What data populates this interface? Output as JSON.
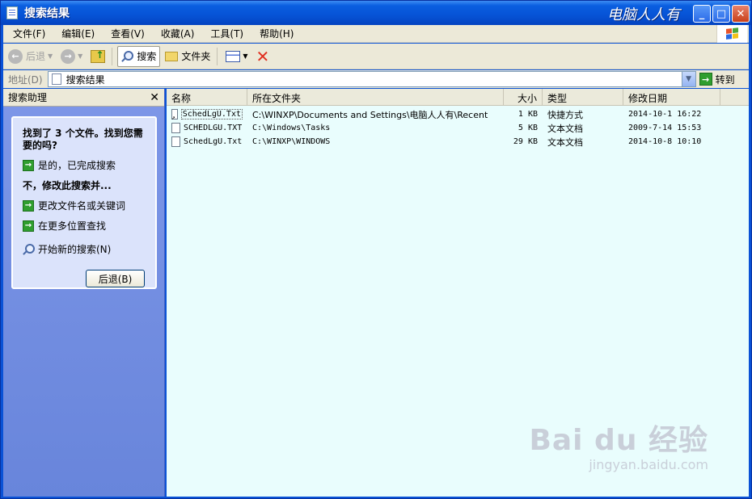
{
  "window": {
    "title": "搜索结果",
    "watermark_title": "电脑人人有",
    "buttons": {
      "minimize": "_",
      "maximize": "□",
      "close": "✕"
    }
  },
  "menu": [
    "文件(F)",
    "编辑(E)",
    "查看(V)",
    "收藏(A)",
    "工具(T)",
    "帮助(H)"
  ],
  "toolbar": {
    "back": "后退",
    "search": "搜索",
    "folders": "文件夹"
  },
  "address": {
    "label": "地址(D)",
    "value": "搜索结果",
    "go": "转到"
  },
  "search_assistant": {
    "title": "搜索助理",
    "close": "✕",
    "found_text": "找到了 3 个文件。找到您需要的吗?",
    "yes_done": "是的，已完成搜索",
    "no_refine": "不，修改此搜索并...",
    "change_name": "更改文件名或关键词",
    "search_more": "在更多位置查找",
    "new_search": "开始新的搜索(N)",
    "back_button": "后退(B)"
  },
  "results": {
    "columns": [
      "名称",
      "所在文件夹",
      "大小",
      "类型",
      "修改日期"
    ],
    "rows": [
      {
        "name": "SchedLgU.Txt",
        "folder": "C:\\WINXP\\Documents and Settings\\电脑人人有\\Recent",
        "size": "1 KB",
        "type": "快捷方式",
        "modified": "2014-10-1 16:22",
        "icon": "shortcut-icon"
      },
      {
        "name": "SCHEDLGU.TXT",
        "folder": "C:\\Windows\\Tasks",
        "size": "5 KB",
        "type": "文本文档",
        "modified": "2009-7-14 15:53",
        "icon": "text-file-icon"
      },
      {
        "name": "SchedLgU.Txt",
        "folder": "C:\\WINXP\\WINDOWS",
        "size": "29 KB",
        "type": "文本文档",
        "modified": "2014-10-8 10:10",
        "icon": "text-file-icon"
      }
    ]
  },
  "watermark": {
    "logo": "Bai du 经验",
    "url": "jingyan.baidu.com"
  },
  "colors": {
    "titlebar": "#0653d6",
    "taskpane": "#7e97e8",
    "content_bg": "#e9fdfd"
  }
}
